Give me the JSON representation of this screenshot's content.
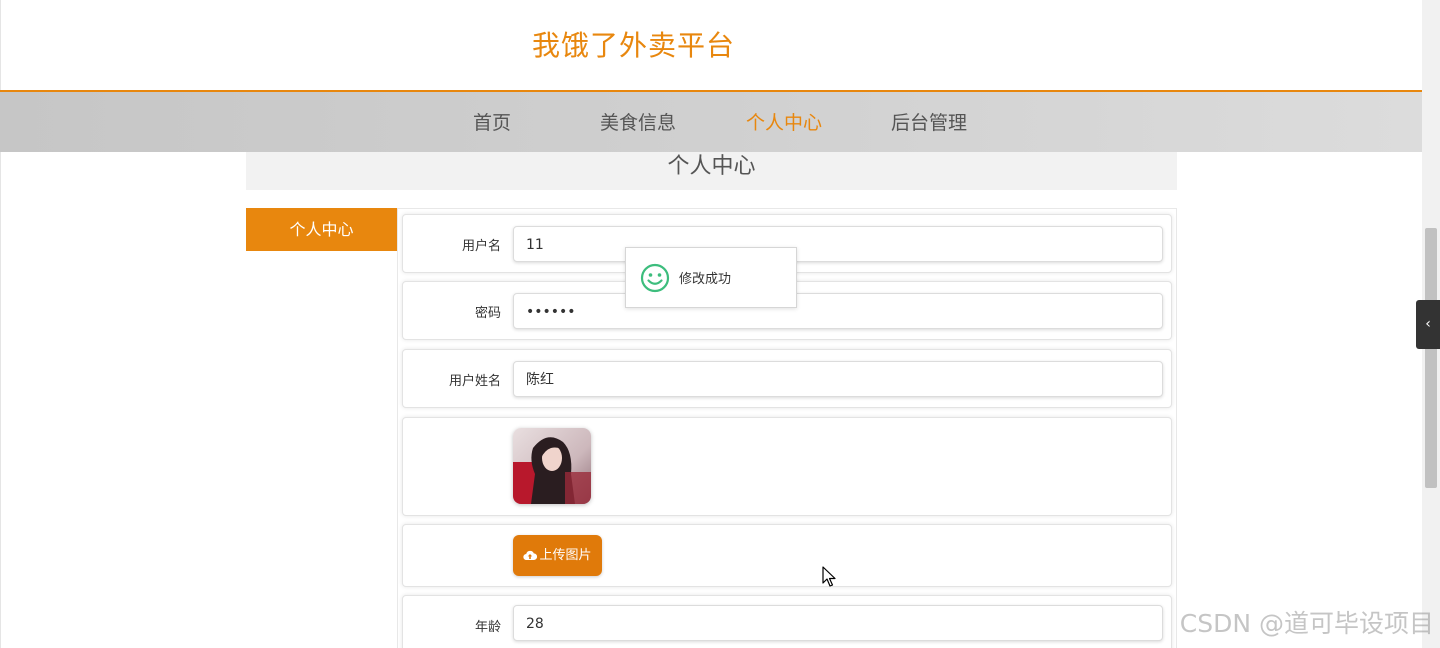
{
  "header": {
    "site_title": "我饿了外卖平台"
  },
  "nav": {
    "items": [
      {
        "label": "首页",
        "active": false
      },
      {
        "label": "美食信息",
        "active": false
      },
      {
        "label": "个人中心",
        "active": true
      },
      {
        "label": "后台管理",
        "active": false
      }
    ]
  },
  "section": {
    "title": "个人中心"
  },
  "side_menu": {
    "items": [
      {
        "label": "个人中心",
        "active": true
      }
    ]
  },
  "form": {
    "username": {
      "label": "用户名",
      "value": "11"
    },
    "password": {
      "label": "密码",
      "value": "••••••"
    },
    "real_name": {
      "label": "用户姓名",
      "value": "陈红"
    },
    "avatar": {
      "icon": "user-avatar-photo"
    },
    "upload": {
      "label": "上传图片",
      "icon": "cloud-upload-icon"
    },
    "age": {
      "label": "年龄",
      "value": "28"
    }
  },
  "toast": {
    "message": "修改成功",
    "icon": "smile-icon"
  },
  "watermark": {
    "text": "CSDN @道可毕设项目"
  },
  "colors": {
    "brand": "#e8870e",
    "toast_icon": "#3dbd7d"
  }
}
